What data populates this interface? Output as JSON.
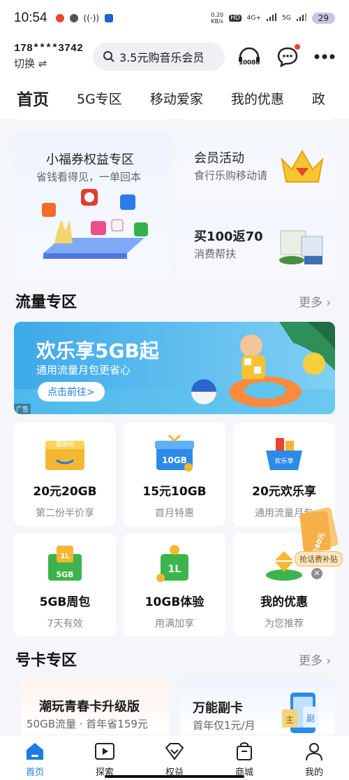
{
  "status_bar": {
    "time": "10:54",
    "speed_value": "0.20",
    "speed_unit": "KB/s",
    "hd": "HD",
    "net1": "4G+",
    "net2": "5G",
    "battery": "29"
  },
  "header": {
    "phone": "178****3742",
    "switch_label": "切换 ⇌",
    "search_placeholder": "3.5元购音乐会员",
    "service_label": "10086"
  },
  "tabs": [
    {
      "label": "首页",
      "active": true
    },
    {
      "label": "5G专区"
    },
    {
      "label": "移动爱家"
    },
    {
      "label": "我的优惠"
    },
    {
      "label": "政"
    }
  ],
  "promos": {
    "coupon": {
      "title": "小福券权益专区",
      "subtitle": "省钱看得见，一单回本"
    },
    "member": {
      "title": "会员活动",
      "subtitle": "食行乐购移动请"
    },
    "cashback": {
      "title": "买100返70",
      "subtitle": "消费帮扶"
    }
  },
  "traffic_section": {
    "title": "流量专区",
    "more": "更多 ›"
  },
  "banner": {
    "headline": "欢乐享5GB起",
    "sub": "通用流量月包更省心",
    "button": "点击前往>",
    "ad_tag": "广告"
  },
  "traffic_items": [
    {
      "title": "20元20GB",
      "subtitle": "第二份半价享",
      "icon_label": "暑期包"
    },
    {
      "title": "15元10GB",
      "subtitle": "首月特惠",
      "icon_label": "10GB"
    },
    {
      "title": "20元欢乐享",
      "subtitle": "通用流量月包",
      "icon_label": "欢乐享"
    },
    {
      "title": "5GB周包",
      "subtitle": "7天有效",
      "icon_label": "5GB"
    },
    {
      "title": "10GB体验",
      "subtitle": "用满加享",
      "icon_label": "1L"
    },
    {
      "title": "我的优惠",
      "subtitle": "为您推荐",
      "icon_label": ""
    }
  ],
  "floating_badge": {
    "amount": "240元",
    "label": "抢话费补贴"
  },
  "card_section": {
    "title": "号卡专区",
    "more": "更多 ›"
  },
  "card_items": [
    {
      "title": "潮玩青春卡升级版",
      "subtitle": "50GB流量 · 首年省159元"
    },
    {
      "title": "万能副卡",
      "subtitle": "首年仅1元/月",
      "tag1": "主",
      "tag2": "副"
    }
  ],
  "nav": [
    {
      "label": "首页",
      "icon": "home-icon",
      "active": true
    },
    {
      "label": "探索",
      "icon": "play-icon"
    },
    {
      "label": "权益",
      "icon": "diamond-icon"
    },
    {
      "label": "商城",
      "icon": "shopping-bag-icon"
    },
    {
      "label": "我的",
      "icon": "user-icon"
    }
  ],
  "colors": {
    "accent": "#1f7ae0",
    "banner_bg": "#3da9e8",
    "gold": "#f5b731",
    "green": "#3cb44b"
  }
}
